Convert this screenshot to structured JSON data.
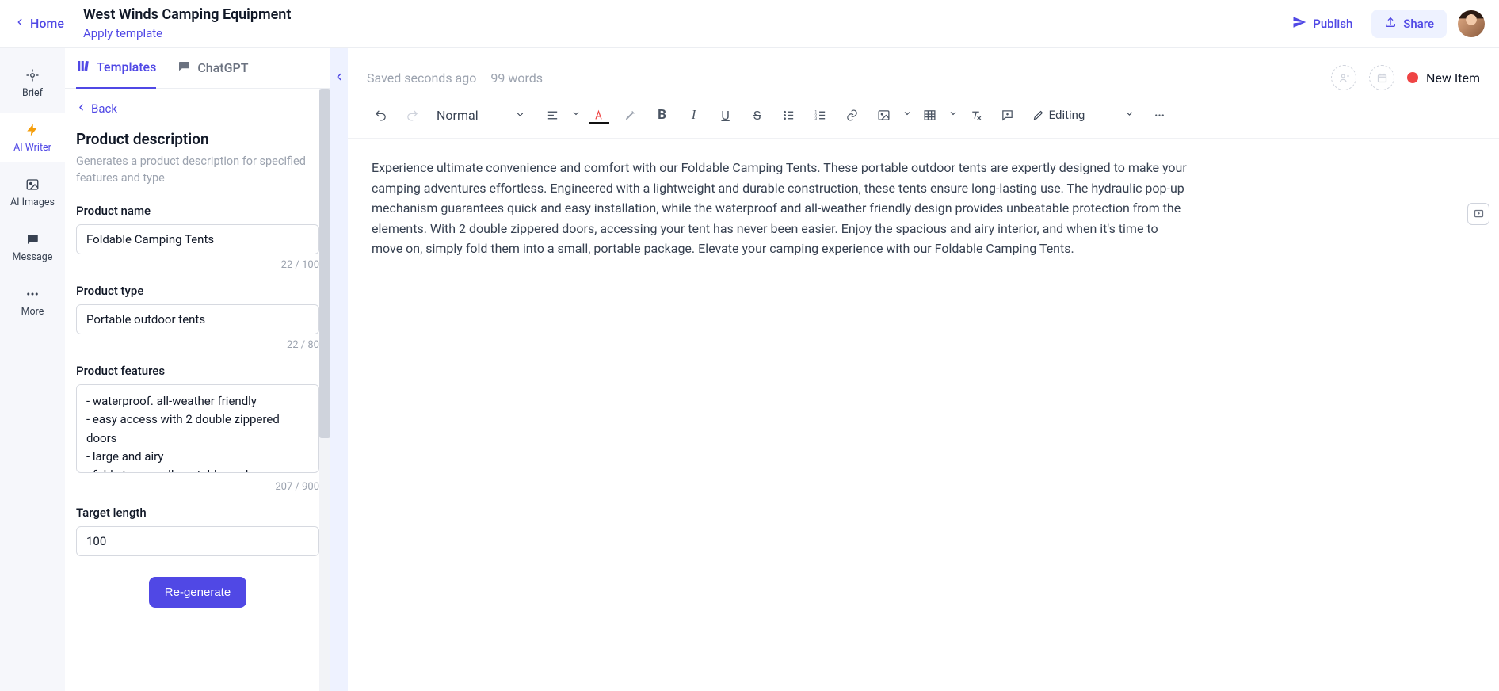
{
  "header": {
    "home_label": "Home",
    "title": "West Winds Camping Equipment",
    "apply_template": "Apply template",
    "publish_label": "Publish",
    "share_label": "Share"
  },
  "leftnav": {
    "brief": "Brief",
    "ai_writer": "AI Writer",
    "ai_images": "AI Images",
    "message": "Message",
    "more": "More"
  },
  "sidebar": {
    "tab_templates": "Templates",
    "tab_chatgpt": "ChatGPT",
    "back": "Back",
    "title": "Product description",
    "subtitle": "Generates a product description for specified features and type",
    "labels": {
      "product_name": "Product name",
      "product_type": "Product type",
      "product_features": "Product features",
      "target_length": "Target length"
    },
    "product_name": "Foldable Camping Tents",
    "product_name_counter": "22 / 100",
    "product_type": "Portable outdoor tents",
    "product_type_counter": "22 / 80",
    "product_features": "- waterproof. all-weather friendly\n- easy access with 2 double zippered doors\n- large and airy\n- folds to a small, portable package",
    "product_features_counter": "207 / 900",
    "target_length": "100",
    "regenerate": "Re-generate"
  },
  "editor": {
    "saved": "Saved seconds ago",
    "word_count": "99 words",
    "status": "New Item",
    "paragraph_style": "Normal",
    "mode": "Editing",
    "body": "Experience ultimate convenience and comfort with our Foldable Camping Tents. These portable outdoor tents are expertly designed to make your camping adventures effortless. Engineered with a lightweight and durable construction, these tents ensure long-lasting use. The hydraulic pop-up mechanism guarantees quick and easy installation, while the waterproof and all-weather friendly design provides unbeatable protection from the elements. With 2 double zippered doors, accessing your tent has never been easier. Enjoy the spacious and airy interior, and when it's time to move on, simply fold them into a small, portable package. Elevate your camping experience with our Foldable Camping Tents."
  }
}
